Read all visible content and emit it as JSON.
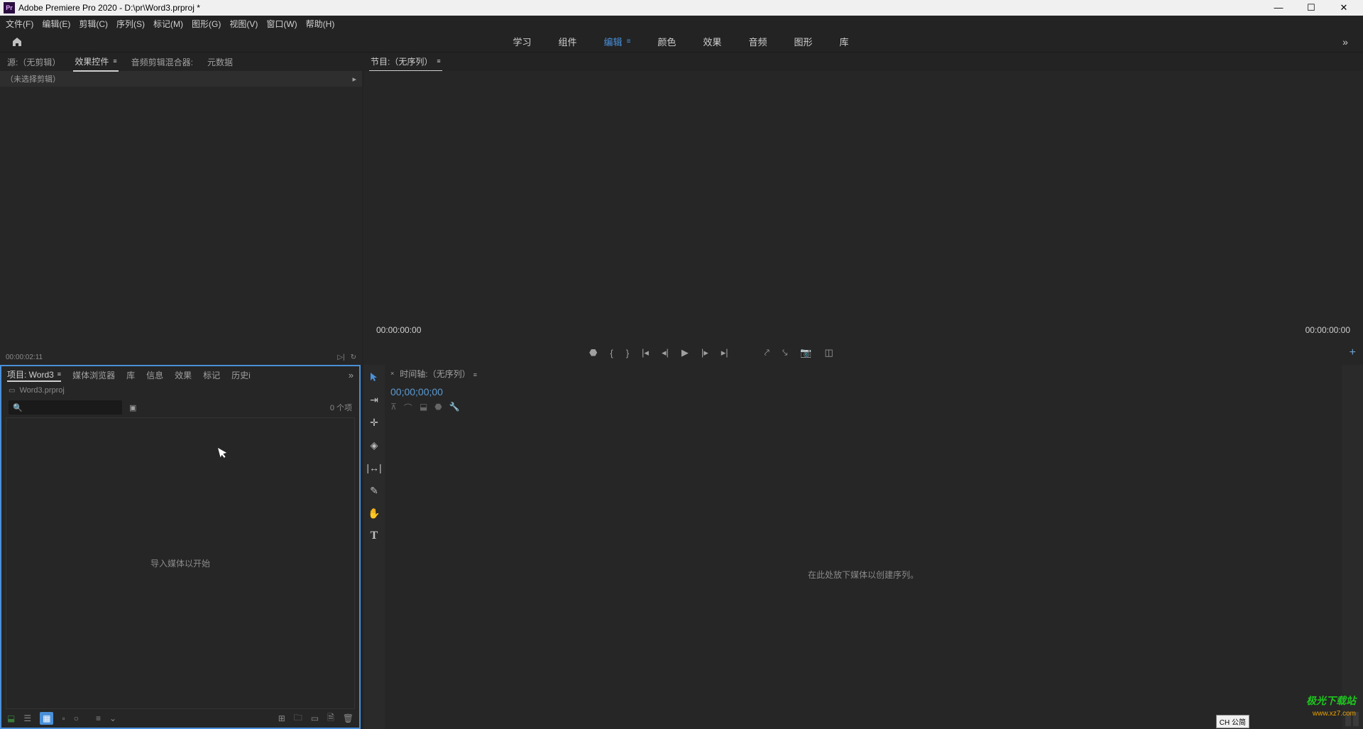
{
  "titlebar": {
    "app_icon_text": "Pr",
    "title": "Adobe Premiere Pro 2020 - D:\\pr\\Word3.prproj *"
  },
  "menubar": {
    "file": "文件(F)",
    "edit": "编辑(E)",
    "clip": "剪辑(C)",
    "sequence": "序列(S)",
    "markers": "标记(M)",
    "graphics": "图形(G)",
    "view": "视图(V)",
    "window": "窗口(W)",
    "help": "帮助(H)"
  },
  "workspaces": {
    "learning": "学习",
    "assembly": "组件",
    "editing": "编辑",
    "color": "颜色",
    "effects": "效果",
    "audio": "音频",
    "graphics": "图形",
    "libraries": "库",
    "more": "»"
  },
  "source_tabs": {
    "source": "源:（无剪辑）",
    "effect_controls": "效果控件",
    "audio_mixer": "音频剪辑混合器:",
    "metadata": "元数据"
  },
  "source_panel": {
    "no_clip": "（未选择剪辑）",
    "timecode": "00:00:02:11"
  },
  "program_tabs": {
    "program": "节目:（无序列）"
  },
  "program_panel": {
    "time_left": "00:00:00:00",
    "time_right": "00:00:00:00"
  },
  "project_tabs": {
    "project": "项目: Word3",
    "media_browser": "媒体浏览器",
    "libraries": "库",
    "info": "信息",
    "effects": "效果",
    "markers": "标记",
    "history": "历史i",
    "more": "»"
  },
  "project_panel": {
    "filename": "Word3.prproj",
    "search_placeholder": "",
    "item_count": "0 个项",
    "import_hint": "导入媒体以开始"
  },
  "timeline_tabs": {
    "timeline": "时间轴:（无序列）"
  },
  "timeline_panel": {
    "timecode": "00;00;00;00",
    "drop_hint": "在此处放下媒体以创建序列。"
  },
  "watermark": {
    "title": "极光下载站",
    "url": "www.xz7.com"
  },
  "ime": "CH 公简"
}
